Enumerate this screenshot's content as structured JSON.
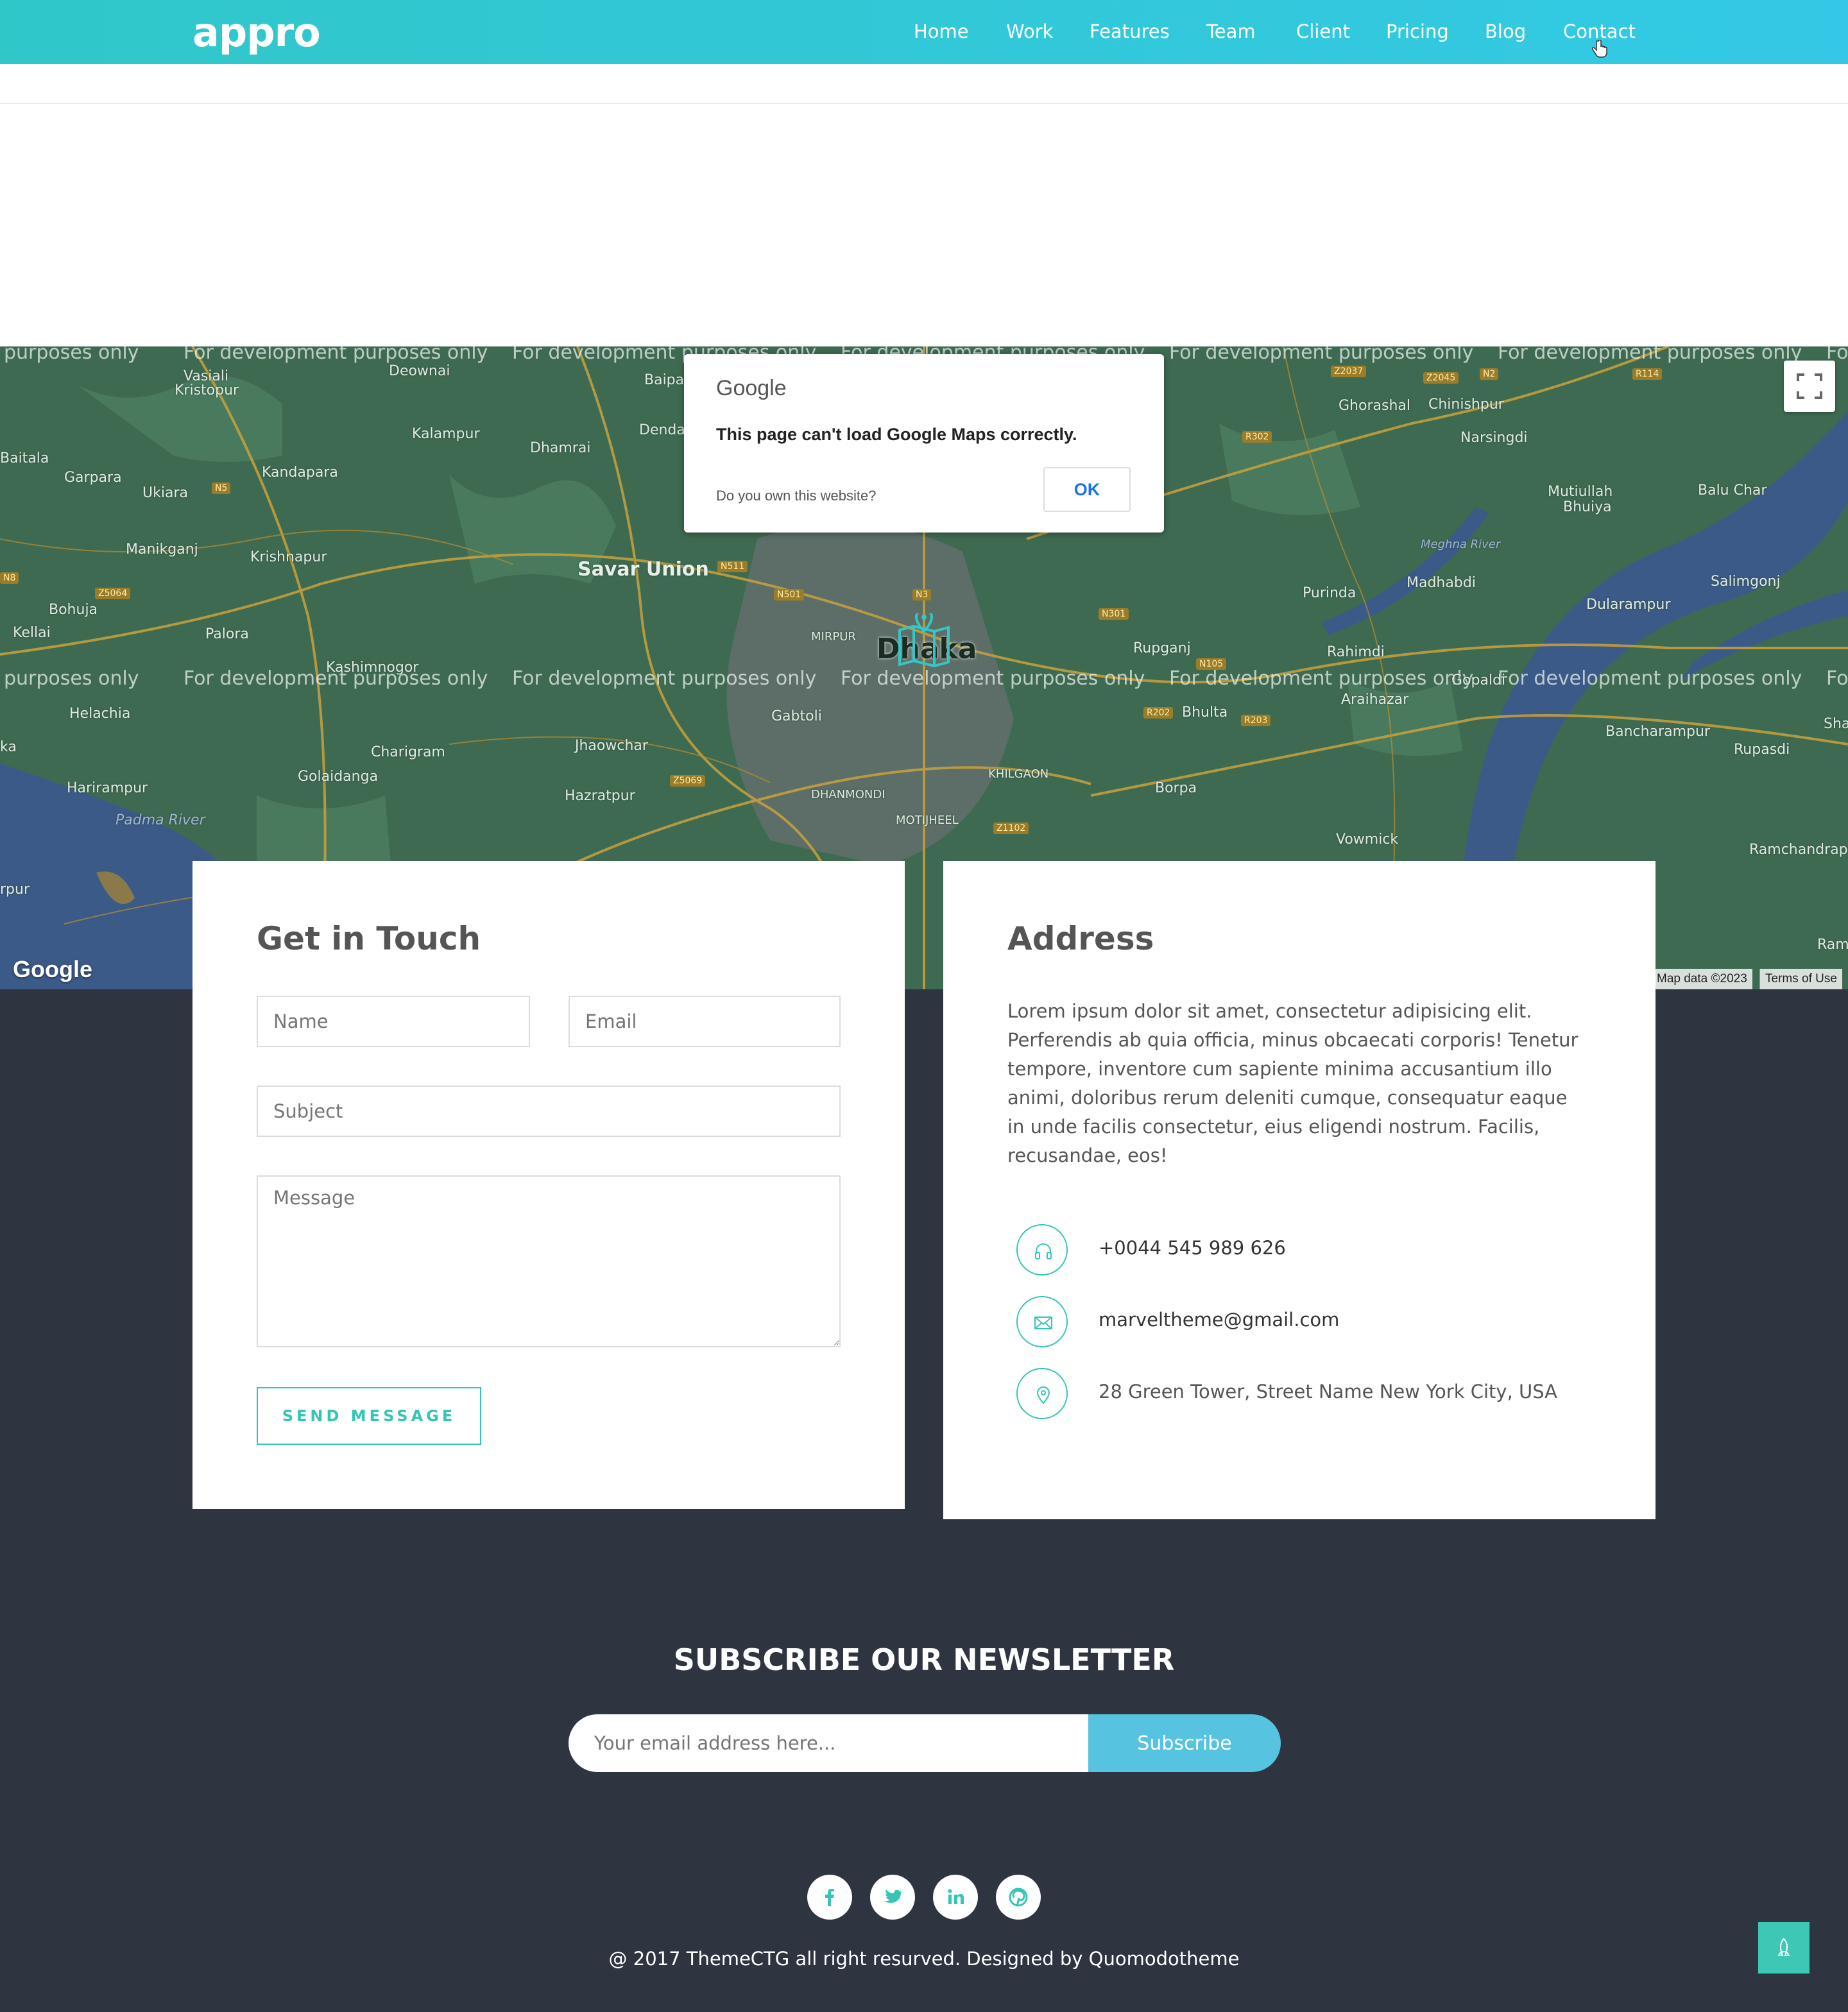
{
  "navbar": {
    "logo": "appro",
    "items": [
      "Home",
      "Work",
      "Features",
      "Team",
      "Client",
      "Pricing",
      "Blog",
      "Contact"
    ]
  },
  "map": {
    "error_brand": "Google",
    "error_message": "This page can't load Google Maps correctly.",
    "error_question": "Do you own this website?",
    "ok_label": "OK",
    "watermark": "For development purposes only",
    "watermark_cut_left": "purposes only",
    "watermark_cut_right": "Fo",
    "google_logo": "Google",
    "attribution": "Map data ©2023",
    "terms": "Terms of Use",
    "places": {
      "vasiali": "Vasiali",
      "kristopur": "Kristopur",
      "deownai": "Deownai",
      "baipal": "Baipa",
      "dendabor": "Dendabor",
      "kalampur": "Kalampur",
      "dhamrai": "Dhamrai",
      "garpara": "Garpara",
      "ukiara": "Ukiara",
      "kandapara": "Kandapara",
      "baitala": "Baitala",
      "manikganj": "Manikganj",
      "krishnapur": "Krishnapur",
      "savar": "Savar Union",
      "bohuja": "Bohuja",
      "kellai": "Kellai",
      "palora": "Palora",
      "kashimnogor": "Kashimnogor",
      "helachia": "Helachia",
      "charigram": "Charigram",
      "golaidanga": "Golaidanga",
      "jhaowchar": "Jhaowchar",
      "harirampur": "Harirampur",
      "hazratpur": "Hazratpur",
      "padma": "Padma River",
      "gabtoli": "Gabtoli",
      "mirpur": "MIRPUR",
      "dhaka": "Dhaka",
      "dhanmondi": "DHANMONDI",
      "motijheel": "MOTIJHEEL",
      "khilgaon": "KHILGAON",
      "ghorashal": "Ghorashal",
      "chinishpur": "Chinishpur",
      "narsingdi": "Narsingdi",
      "mutiullah": "Mutiullah",
      "bhuiya": "Bhuiya",
      "balu_char": "Balu Char",
      "purinda": "Purinda",
      "madhabdi": "Madhabdi",
      "salimgonj": "Salimgonj",
      "rupganj": "Rupganj",
      "rahimdi": "Rahimdi",
      "araihazar": "Araihazar",
      "gopaldi": "Gopaldi",
      "bhulta": "Bhulta",
      "dularampur": "Dularampur",
      "bancharampur": "Bancharampur",
      "rupasdi": "Rupasdi",
      "borpa": "Borpa",
      "vowmick": "Vowmick",
      "ramchandrapur": "Ramchandrap",
      "meghna": "Meghna River",
      "rampur": "Ramp",
      "sha": "Sha",
      "ka": "ka",
      "rpur": "rpur"
    },
    "roads": [
      "N5",
      "Z5064",
      "N511",
      "N501",
      "N3",
      "N301",
      "N105",
      "R202",
      "R203",
      "R302",
      "Z2037",
      "Z2045",
      "N2",
      "R114",
      "Z5069",
      "Z1102",
      "N8"
    ]
  },
  "contact": {
    "title": "Get in Touch",
    "name_placeholder": "Name",
    "email_placeholder": "Email",
    "subject_placeholder": "Subject",
    "message_placeholder": "Message",
    "send_label": "SEND MESSAGE"
  },
  "address": {
    "title": "Address",
    "text": "Lorem ipsum dolor sit amet, consectetur adipisicing elit. Perferendis ab quia officia, minus obcaecati corporis! Tenetur tempore, inventore cum sapiente minima accusantium illo animi, doloribus rerum deleniti cumque, consequatur eaque in unde facilis consectetur, eius eligendi nostrum. Facilis, recusandae, eos!",
    "phone": "+0044 545 989 626",
    "email": "marveltheme@gmail.com",
    "location": "28 Green Tower, Street Name New York City, USA",
    "icons": [
      "headphones-icon",
      "envelope-icon",
      "map-pin-icon"
    ]
  },
  "newsletter": {
    "title": "SUBSCRIBE OUR NEWSLETTER",
    "placeholder": "Your email address here...",
    "button": "Subscribe"
  },
  "footer": {
    "social": [
      "facebook-icon",
      "twitter-icon",
      "linkedin-icon",
      "pinterest-icon"
    ],
    "copyright": "@ 2017 ThemeCTG all right resurved. Designed by Quomodotheme"
  },
  "colors": {
    "nav_gradient_start": "#2fc8c9",
    "nav_gradient_end": "#33c9e6",
    "accent": "#34c5b5",
    "subscribe": "#56c3e0",
    "dark_bg": "#2e3440"
  }
}
